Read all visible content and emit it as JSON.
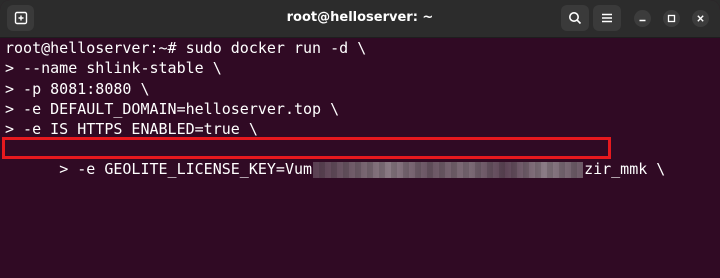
{
  "window": {
    "title": "root@helloserver: ~",
    "colors": {
      "titlebar": "#2c2c2c",
      "terminal_bg": "#300a24",
      "text": "#ffffff",
      "highlight": "#e6191e"
    }
  },
  "titlebar": {
    "icons": [
      "new-tab-icon",
      "search-icon",
      "menu-icon",
      "minimize-icon",
      "maximize-icon",
      "close-icon"
    ]
  },
  "terminal": {
    "lines": [
      "root@helloserver:~# sudo docker run -d \\",
      "> --name shlink-stable \\",
      "> -p 8081:8080 \\",
      "> -e DEFAULT_DOMAIN=helloserver.top \\",
      "> -e IS_HTTPS_ENABLED=true \\"
    ],
    "highlighted_line": {
      "prefix": "> -e GEOLITE_LICENSE_KEY=Vum",
      "suffix": "zir_mmk \\"
    }
  }
}
